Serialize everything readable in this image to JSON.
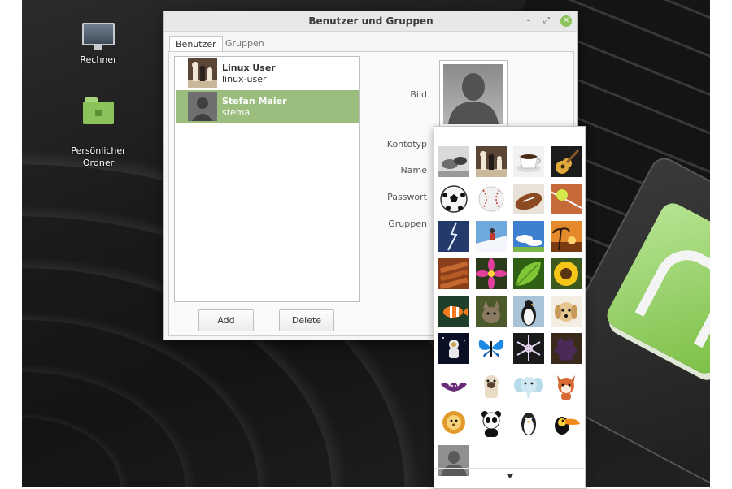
{
  "desktop": {
    "icons": [
      {
        "label": "Rechner",
        "icon": "computer-icon"
      },
      {
        "label": "Persönlicher\nOrdner",
        "icon": "home-folder-icon"
      }
    ]
  },
  "window": {
    "title": "Benutzer und Gruppen",
    "controls": {
      "minimize": "–",
      "maximize": "⤢",
      "close": "✕"
    },
    "tabs": [
      {
        "label": "Benutzer",
        "active": true
      },
      {
        "label": "Gruppen",
        "active": false
      }
    ],
    "users": [
      {
        "name": "Linux User",
        "login": "linux-user",
        "avatar": "chess-avatar",
        "selected": false
      },
      {
        "name": "Stefan Maier",
        "login": "stema",
        "avatar": "default-person-avatar",
        "selected": true
      }
    ],
    "buttons": {
      "add": "Add",
      "delete": "Delete"
    },
    "fields": {
      "picture": "Bild",
      "account_type": "Kontotyp",
      "name": "Name",
      "password": "Passwort",
      "groups": "Gruppen"
    }
  },
  "picker": {
    "items": [
      "stone-tools",
      "chess-pieces",
      "coffee-cup",
      "guitar",
      "soccer-ball",
      "baseball",
      "american-football",
      "tennis-ball",
      "lightning",
      "snowboarder",
      "sky-clouds",
      "sunset-palm",
      "cinnamon-sticks",
      "pink-flower",
      "green-leaf",
      "sunflower",
      "clownfish",
      "kitten",
      "penguin",
      "puppy",
      "astronaut",
      "butterfly",
      "snowflake",
      "grapes",
      "bat",
      "pug",
      "elephant",
      "fox",
      "lion",
      "panda",
      "penguin-cartoon",
      "toucan",
      "default-person"
    ],
    "more": "▾"
  },
  "colors": {
    "selection": "#9bbd7e",
    "accent": "#8ac35b",
    "mint_logo": "#8fcf5b"
  }
}
